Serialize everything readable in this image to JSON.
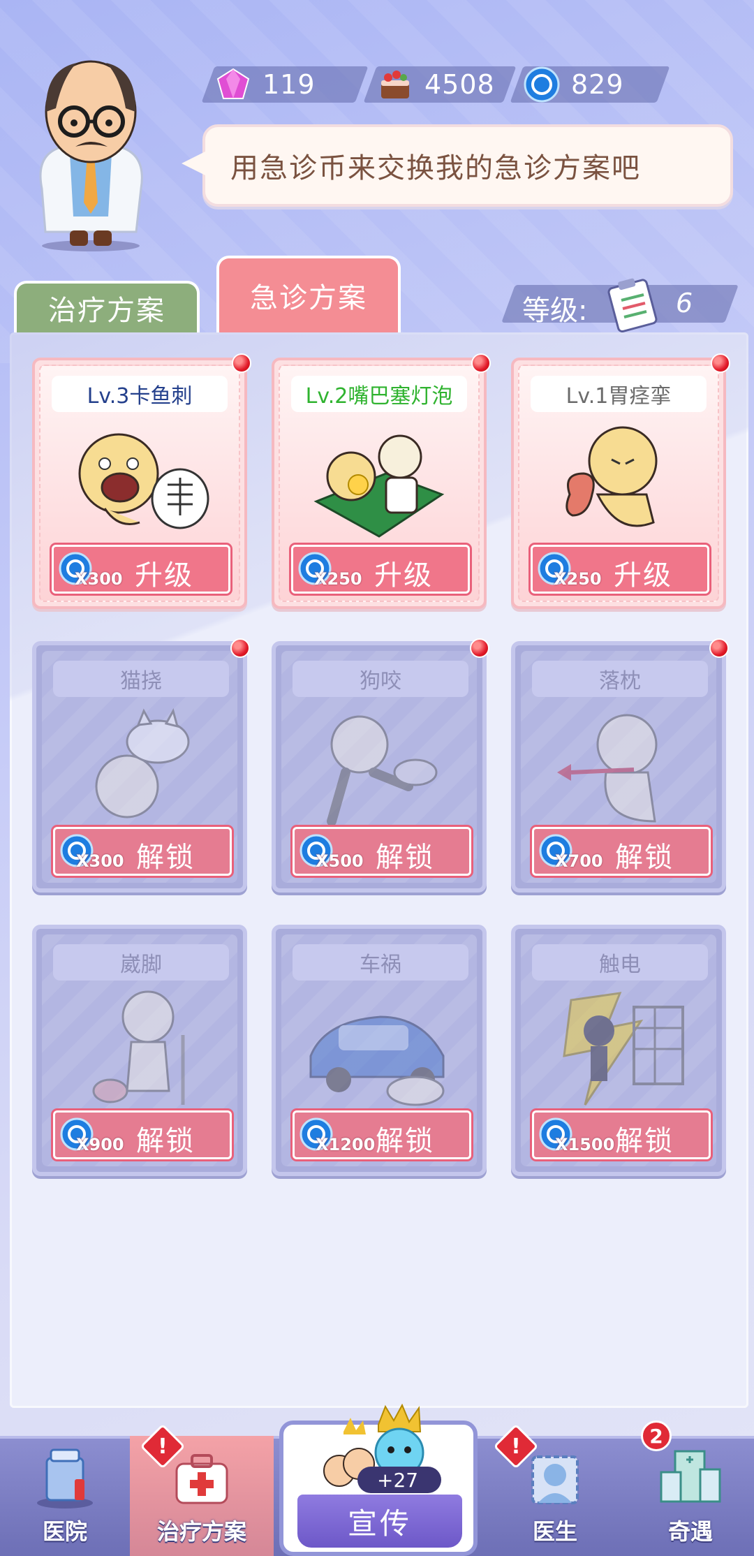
{
  "currency": {
    "gems": "119",
    "cakes": "4508",
    "coins": "829"
  },
  "speech": "用急诊币来交换我的急诊方案吧",
  "tabs": {
    "treatment": "治疗方案",
    "emergency": "急诊方案"
  },
  "level": {
    "label": "等级:",
    "value": "6"
  },
  "cards": [
    {
      "title": "Lv.3卡鱼刺",
      "cost": "X300",
      "action": "升级",
      "title_color": "#24408c"
    },
    {
      "title": "Lv.2嘴巴塞灯泡",
      "cost": "X250",
      "action": "升级",
      "title_color": "#2fb32f"
    },
    {
      "title": "Lv.1胃痉挛",
      "cost": "X250",
      "action": "升级",
      "title_color": "#6b6b6b"
    },
    {
      "title": "猫挠",
      "cost": "X300",
      "action": "解锁"
    },
    {
      "title": "狗咬",
      "cost": "X500",
      "action": "解锁"
    },
    {
      "title": "落枕",
      "cost": "X700",
      "action": "解锁"
    },
    {
      "title": "崴脚",
      "cost": "X900",
      "action": "解锁"
    },
    {
      "title": "车祸",
      "cost": "X1200",
      "action": "解锁"
    },
    {
      "title": "触电",
      "cost": "X1500",
      "action": "解锁"
    }
  ],
  "nav": {
    "hospital": "医院",
    "treatment": "治疗方案",
    "promo": "宣传",
    "promo_count": "+27",
    "doctor": "医生",
    "adventure": "奇遇",
    "adventure_badge": "2",
    "alert": "!"
  }
}
